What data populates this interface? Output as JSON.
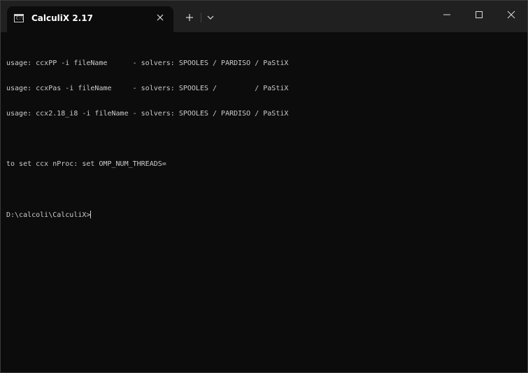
{
  "window": {
    "tab_title": "CalculiX 2.17",
    "tab_icon": "terminal-icon",
    "tab_icon_text": "C:\\"
  },
  "terminal": {
    "lines": [
      "usage: ccxPP -i fileName      - solvers: SPOOLES / PARDISO / PaStiX",
      "usage: ccxPas -i fileName     - solvers: SPOOLES /         / PaStiX",
      "usage: ccx2.18_i8 -i fileName - solvers: SPOOLES / PARDISO / PaStiX",
      "",
      "to set ccx nProc: set OMP_NUM_THREADS=",
      "",
      "D:\\calcoli\\CalculiX>"
    ]
  }
}
